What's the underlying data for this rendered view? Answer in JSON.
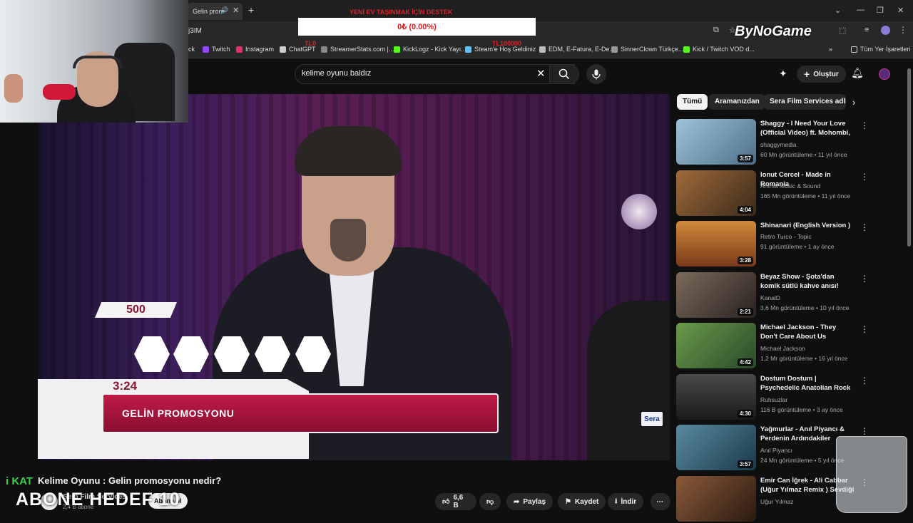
{
  "browser": {
    "tab_title": "Gelin prom",
    "address_fragment": "j3IM",
    "bookmarks": [
      {
        "label": "ck",
        "color": "#ffffff"
      },
      {
        "label": "Twitch",
        "color": "#9146ff"
      },
      {
        "label": "Instagram",
        "color": "#e1306c"
      },
      {
        "label": "ChatGPT",
        "color": "#cccccc"
      },
      {
        "label": "StreamerStats.com |...",
        "color": "#888888"
      },
      {
        "label": "KickLogz - Kick Yayı...",
        "color": "#53fc18"
      },
      {
        "label": "Steam'e Hoş Geldiniz",
        "color": "#66c0f4"
      },
      {
        "label": "EDM, E-Fatura, E-De...",
        "color": "#bbbbbb"
      },
      {
        "label": "SinnerClown Türkçe...",
        "color": "#999999"
      },
      {
        "label": "Kick / Twitch VOD d...",
        "color": "#53fc18"
      }
    ],
    "all_bookmarks": "Tüm Yer İşaretleri"
  },
  "overlay": {
    "donation_title": "YENİ EV TAŞINMAK İÇİN DESTEK",
    "donation_amount": "0₺ (0.00%)",
    "donation_left": "TL0",
    "donation_right": "TL100000",
    "brand": "ByNoGame",
    "ticker": "i KAT",
    "subscriber_goal": "ABONE HEDEF 10"
  },
  "search": {
    "query": "kelime oyunu baldız"
  },
  "header": {
    "create_label": "Oluştur"
  },
  "video": {
    "title": "Kelime Oyunu : Gelin promosyonu nedir?",
    "channel": "Sera Film Services",
    "subscribers": "2,4 B abone",
    "subscribe_label": "Abone ol",
    "likes": "6,6 B",
    "share_label": "Paylaş",
    "save_label": "Kaydet",
    "download_label": "İndir",
    "overlay_score": "500",
    "overlay_time": "3:24",
    "overlay_caption": "GELİN PROMOSYONU",
    "watermark": "Sera"
  },
  "chips": [
    "Tümü",
    "Aramanızdan",
    "Sera Film Services adlı y"
  ],
  "recommendations": [
    {
      "title": "Shaggy - I Need Your Love (Official Video) ft. Mohombi, ...",
      "channel": "shaggymedia",
      "meta": "60 Mn görüntüleme • 11 yıl önce",
      "duration": "3:57",
      "color": "#6f8fa8"
    },
    {
      "title": "Ionut Cercel - Made in Romania",
      "channel": "Amma Music & Sound",
      "meta": "165 Mn görüntüleme • 11 yıl önce",
      "duration": "4:04",
      "color": "#7a4a2a"
    },
    {
      "title": "Shinanari (English Version )",
      "channel": "Retro Turco - Topic",
      "meta": "91 görüntüleme • 1 ay önce",
      "duration": "3:28",
      "color": "#c47a2a"
    },
    {
      "title": "Beyaz Show - Şota'dan komik sütlü kahve anısı!",
      "channel": "KanalD",
      "meta": "3,6 Mn görüntüleme • 10 yıl önce",
      "duration": "2:21",
      "color": "#5a4a3a"
    },
    {
      "title": "Michael Jackson - They Don't Care About Us",
      "channel": "Michael Jackson",
      "meta": "1,2 Mr görüntüleme • 16 yıl önce",
      "duration": "4:42",
      "color": "#4a7a3a"
    },
    {
      "title": "Dostum Dostum | Psychedelic Anatolian Rock",
      "channel": "Ruhsuzlar",
      "meta": "116 B görüntüleme • 3 ay önce",
      "duration": "4:30",
      "color": "#3a3a3a"
    },
    {
      "title": "Yağmurlar - Anıl Piyancı & Perdenin Ardındakiler",
      "channel": "Anıl Piyancı",
      "meta": "24 Mn görüntüleme • 5 yıl önce",
      "duration": "3:57",
      "color": "#3a5a6a"
    },
    {
      "title": "Emir Can İğrek - Ali Cabbar (Uğur Yılmaz Remix ) Sevdiği K...",
      "channel": "Uğur Yılmaz",
      "meta": "",
      "duration": "",
      "color": "#5a3a2a"
    }
  ]
}
